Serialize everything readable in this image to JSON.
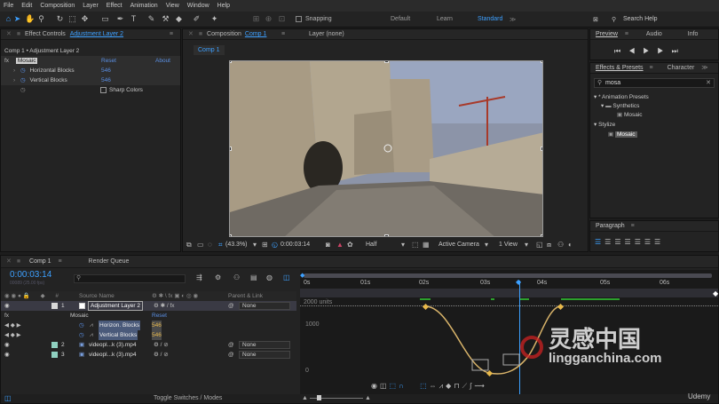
{
  "menu": [
    "File",
    "Edit",
    "Composition",
    "Layer",
    "Effect",
    "Animation",
    "View",
    "Window",
    "Help"
  ],
  "toolbar": {
    "snapping": "Snapping",
    "workspaces": [
      "Default",
      "Learn",
      "Standard"
    ],
    "active_workspace": "Standard",
    "search_placeholder": "Search Help"
  },
  "effect_controls": {
    "tab": "Effect Controls",
    "layer": "Adjustment Layer 2",
    "breadcrumb": "Comp 1 • Adjustment Layer 2",
    "effect": "Mosaic",
    "reset": "Reset",
    "about": "About",
    "props": [
      {
        "name": "Horizontal Blocks",
        "value": "546"
      },
      {
        "name": "Vertical Blocks",
        "value": "546"
      }
    ],
    "sharp_colors": "Sharp Colors"
  },
  "composition": {
    "tab_prefix": "Composition",
    "comp": "Comp 1",
    "layer_tab": "Layer  (none)",
    "view_tab": "Comp 1",
    "zoom": "(43.3%)",
    "time": "0:00:03:14",
    "resolution": "Half",
    "camera": "Active Camera",
    "views": "1 View"
  },
  "preview": {
    "tabs": [
      "Preview",
      "Audio",
      "Info"
    ]
  },
  "effects_presets": {
    "tabs": [
      "Effects & Presets",
      "Character"
    ],
    "search": "mosa",
    "tree": [
      {
        "label": "* Animation Presets"
      },
      {
        "label": "Synthetics"
      },
      {
        "label": "Mosaic"
      },
      {
        "label": "Stylize"
      },
      {
        "label": "Mosaic"
      }
    ]
  },
  "paragraph": {
    "title": "Paragraph"
  },
  "timeline": {
    "tab": "Comp 1",
    "render_queue": "Render Queue",
    "timecode": "0:00:03:14",
    "frames": "00089 (25.00 fps)",
    "columns": {
      "source": "Source Name",
      "parent": "Parent & Link"
    },
    "layers": [
      {
        "num": "1",
        "name": "Adjustment Layer 2",
        "parent": "None"
      },
      {
        "num": "2",
        "name": "videopl...k (3).mp4",
        "parent": "None"
      },
      {
        "num": "3",
        "name": "videopl...k (3).mp4",
        "parent": "None"
      }
    ],
    "effect": "Mosaic",
    "reset": "Reset",
    "props": [
      {
        "name": "Horizon. Blocks",
        "value": "546"
      },
      {
        "name": "Vertical Blocks",
        "value": "546"
      }
    ],
    "ruler": [
      "0s",
      "01s",
      "02s",
      "03s",
      "04s",
      "05s",
      "06s"
    ],
    "units": "2000 units",
    "ticks": [
      "2000",
      "1000",
      "0"
    ],
    "toggle": "Toggle Switches / Modes"
  },
  "watermark": {
    "brand": "Udemy",
    "site": "lingganchina.com",
    "cn": "灵感中国"
  },
  "colors": {
    "accent": "#3da0ff",
    "keyframe": "#e8b94a",
    "curve": "#d9b46a",
    "selection": "#4a7bd8"
  }
}
